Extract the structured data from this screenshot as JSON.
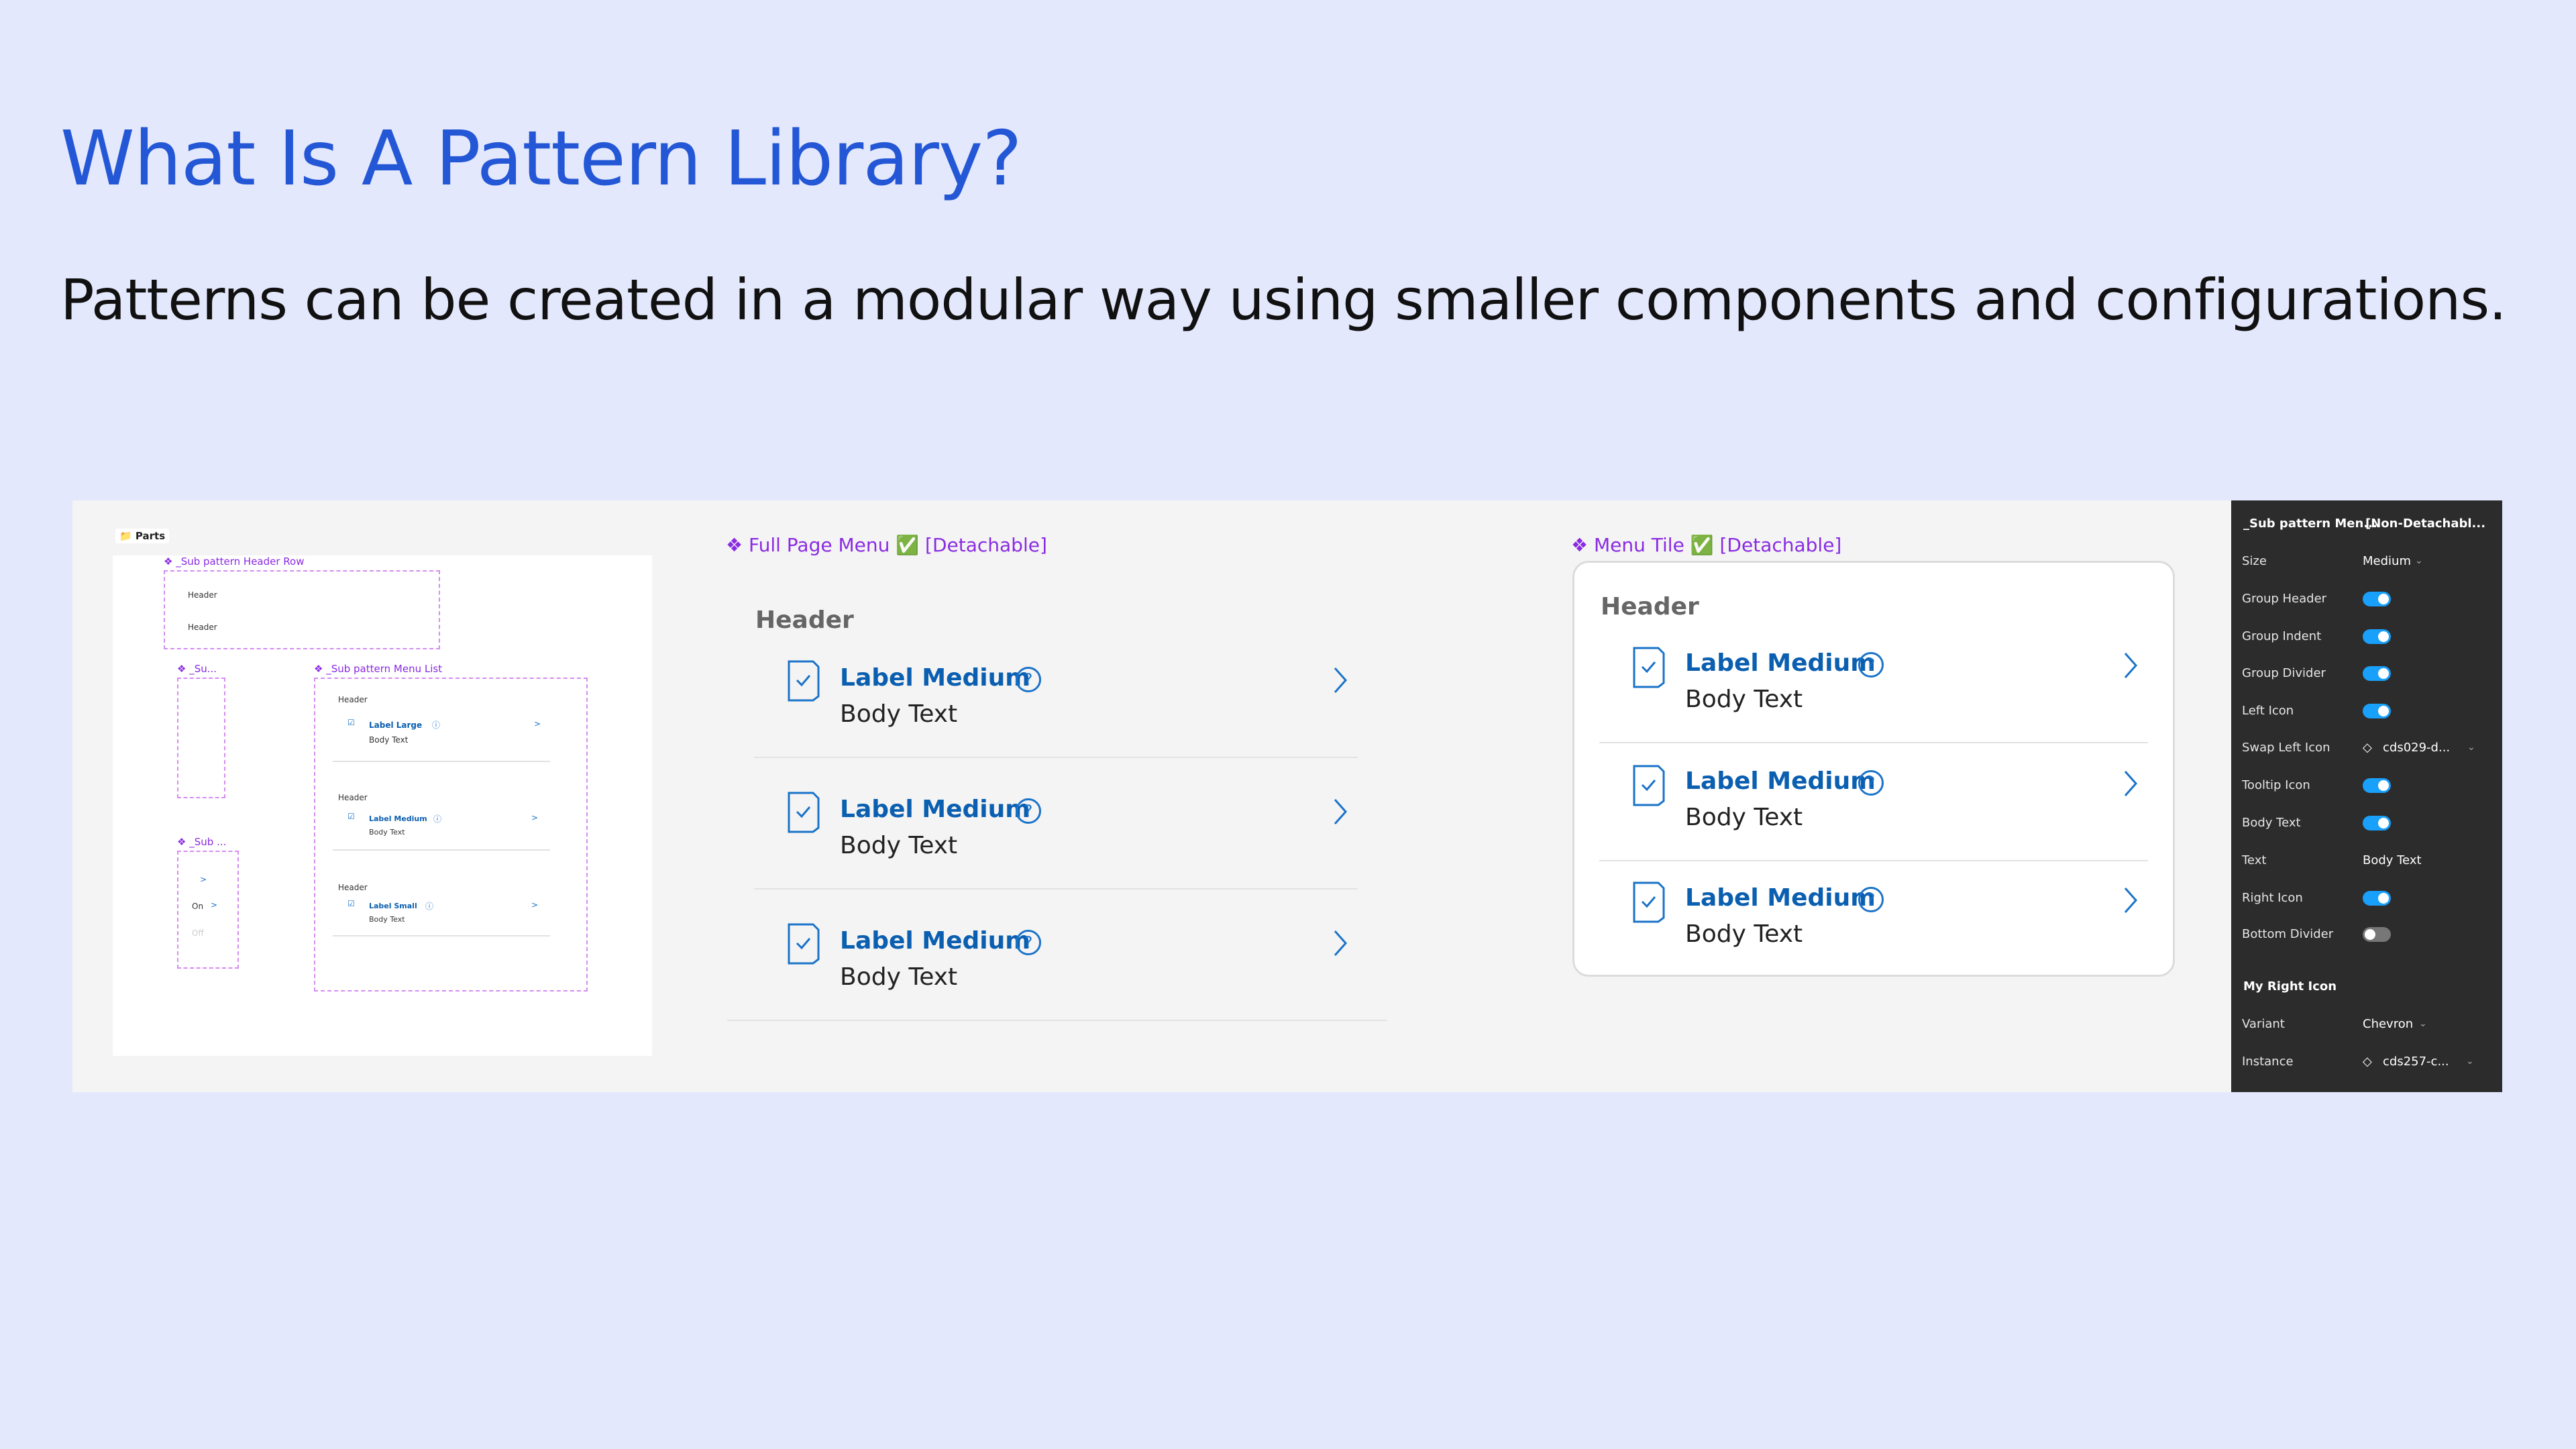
{
  "slide": {
    "title": "What Is A Pattern Library?",
    "subtitle": "Patterns can be created in a modular way using smaller components and configurations."
  },
  "parts": {
    "frame_label": "Parts",
    "header_row": {
      "label": "❖ _Sub pattern Header Row",
      "line1": "Header",
      "line2": "Header"
    },
    "sub1_label": "❖ _Su...",
    "sub2_label": "❖ _Sub ...",
    "sub2_on": "On",
    "sub2_off": "Off",
    "menu_list": {
      "label": "❖ _Sub pattern Menu List",
      "groups": [
        {
          "header": "Header",
          "label": "Label Large",
          "body": "Body Text"
        },
        {
          "header": "Header",
          "label": "Label Medium",
          "body": "Body Text"
        },
        {
          "header": "Header",
          "label": "Label Small",
          "body": "Body Text"
        }
      ]
    }
  },
  "full_page_menu": {
    "title": "❖ Full Page Menu",
    "check": "✅",
    "tag": "[Detachable]",
    "header": "Header",
    "rows": [
      {
        "label": "Label Medium",
        "body": "Body Text"
      },
      {
        "label": "Label Medium",
        "body": "Body Text"
      },
      {
        "label": "Label Medium",
        "body": "Body Text"
      }
    ]
  },
  "menu_tile": {
    "title": "❖ Menu Tile",
    "check": "✅",
    "tag": "[Detachable]",
    "header": "Header",
    "rows": [
      {
        "label": "Label Medium",
        "body": "Body Text"
      },
      {
        "label": "Label Medium",
        "body": "Body Text"
      },
      {
        "label": "Label Medium",
        "body": "Body Text"
      }
    ]
  },
  "properties": {
    "component_name": "_Sub pattern Men...",
    "component_tag": "[Non-Detachabl...",
    "rows": [
      {
        "label": "Size",
        "value": "Medium",
        "kind": "select"
      },
      {
        "label": "Group Header",
        "on": true,
        "kind": "toggle"
      },
      {
        "label": "Group Indent",
        "on": true,
        "kind": "toggle"
      },
      {
        "label": "Group Divider",
        "on": true,
        "kind": "toggle"
      },
      {
        "label": "Left Icon",
        "on": true,
        "kind": "toggle"
      },
      {
        "label": "Swap Left Icon",
        "value": "cds029-d...",
        "kind": "instance"
      },
      {
        "label": "Tooltip Icon",
        "on": true,
        "kind": "toggle"
      },
      {
        "label": "Body Text",
        "on": true,
        "kind": "toggle"
      },
      {
        "label": "Text",
        "value": "Body Text",
        "kind": "text"
      },
      {
        "label": "Right Icon",
        "on": true,
        "kind": "toggle"
      },
      {
        "label": "Bottom Divider",
        "on": false,
        "kind": "toggle"
      }
    ],
    "section_title": "My Right Icon",
    "section_rows": [
      {
        "label": "Variant",
        "value": "Chevron",
        "kind": "select"
      },
      {
        "label": "Instance",
        "value": "cds257-c...",
        "kind": "instance"
      }
    ]
  },
  "colors": {
    "background": "#e4e8fc",
    "title": "#2457d6",
    "accent_blue": "#0b5fb0",
    "toggle_on": "#18a0fb",
    "component_purple": "#8a2be2"
  }
}
